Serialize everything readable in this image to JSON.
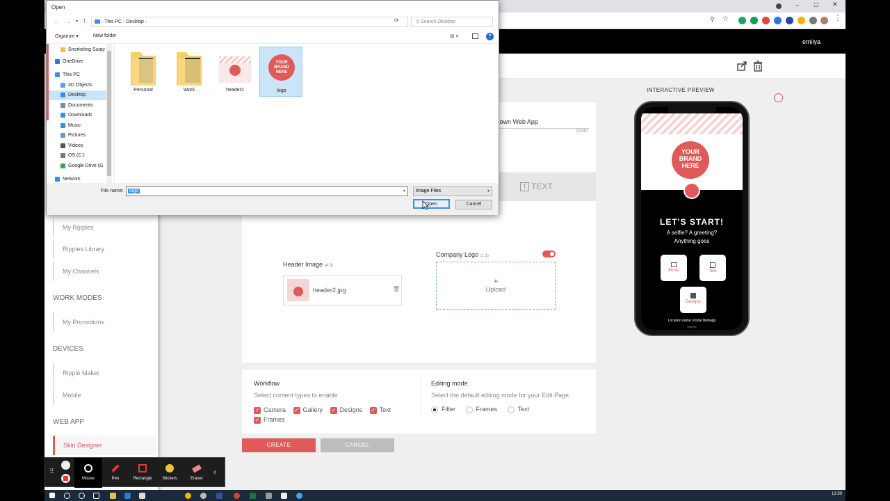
{
  "browser": {
    "user_name": "emilya"
  },
  "sidebar": {
    "items_top": [
      "My Ripples",
      "Ripples Library",
      "My Channels"
    ],
    "section_work_modes": "WORK MODES",
    "items_work_modes": [
      "My Promotions"
    ],
    "section_devices": "DEVICES",
    "items_devices": [
      "Ripple Maker",
      "Mobile"
    ],
    "section_web_app": "WEB APP",
    "items_web_app": [
      "Skin Designer"
    ]
  },
  "editor": {
    "title_value": "ur own Web App",
    "char_count": "22/30",
    "tab_text_label": "TEXT",
    "header_image_label": "Header Image",
    "header_image_ratio": "(4:3)",
    "header_file_name": "header2.jpg",
    "company_logo_label": "Company Logo",
    "company_logo_ratio": "(1:1)",
    "upload_label": "Upload",
    "upload_plus": "+"
  },
  "workflow": {
    "title": "Workflow",
    "description": "Select content types to enable",
    "options": [
      "Camera",
      "Gallery",
      "Designs",
      "Text",
      "Frames"
    ],
    "checkmark": "✓"
  },
  "editing_mode": {
    "title": "Editing mode",
    "description": "Select the default editing mode for your Edit Page",
    "options": [
      "Filter",
      "Frames",
      "Text"
    ],
    "selected": "Filter"
  },
  "actions": {
    "create_label": "CREATE",
    "cancel_label": "CANCEL"
  },
  "preview": {
    "title": "INTERACTIVE PREVIEW",
    "brand_line1": "YOUR",
    "brand_line2": "BRAND",
    "brand_line3": "HERE",
    "heading": "LET'S START!",
    "subheading_line1": "A selfie? A greeting?",
    "subheading_line2": "Anything goes",
    "tiles": [
      "Photo",
      "Text",
      "Designs"
    ],
    "footer_text": "Location name: Portal Webapp",
    "footer_sub": "Ripples"
  },
  "dialog": {
    "title": "Open",
    "breadcrumb": [
      "This PC",
      "Desktop"
    ],
    "search_placeholder": "Search Desktop",
    "organize_label": "Organize ▾",
    "new_folder_label": "New folder",
    "tree": [
      {
        "label": "Snorkeling Sutay",
        "icon": "folder-icon",
        "color": "#e8c04a"
      },
      {
        "label": "OneDrive",
        "icon": "cloud-icon",
        "color": "#2b79d8"
      },
      {
        "label": "This PC",
        "icon": "computer-icon",
        "color": "#3a8ee6"
      },
      {
        "label": "3D Objects",
        "icon": "cube-icon",
        "color": "#55a4e8"
      },
      {
        "label": "Desktop",
        "icon": "desktop-icon",
        "color": "#3a8ee6"
      },
      {
        "label": "Documents",
        "icon": "documents-icon",
        "color": "#7a8c9c"
      },
      {
        "label": "Downloads",
        "icon": "downloads-icon",
        "color": "#3a8ee6"
      },
      {
        "label": "Music",
        "icon": "music-icon",
        "color": "#3a8ee6"
      },
      {
        "label": "Pictures",
        "icon": "pictures-icon",
        "color": "#6b9bc7"
      },
      {
        "label": "Videos",
        "icon": "videos-icon",
        "color": "#555"
      },
      {
        "label": "OS (C:)",
        "icon": "drive-icon",
        "color": "#777"
      },
      {
        "label": "Google Drive (G",
        "icon": "google-drive-icon",
        "color": "#34a853"
      },
      {
        "label": "Network",
        "icon": "network-icon",
        "color": "#3a8ee6"
      }
    ],
    "files": [
      {
        "name": "Personal",
        "type": "folder"
      },
      {
        "name": "Work",
        "type": "folder"
      },
      {
        "name": "header2",
        "type": "image"
      },
      {
        "name": "logo",
        "type": "image"
      }
    ],
    "file_name_label": "File name:",
    "file_name_value": "logo",
    "file_type_value": "Image Files",
    "open_label": "Open",
    "cancel_label": "Cancel"
  },
  "recorder": {
    "tools": [
      "Mouse",
      "Pen",
      "Rectangle",
      "Stickers",
      "Eraser"
    ]
  },
  "taskbar": {
    "clock": "12:50"
  },
  "colors": {
    "accent": "#e05a5a",
    "dark": "#000000"
  }
}
